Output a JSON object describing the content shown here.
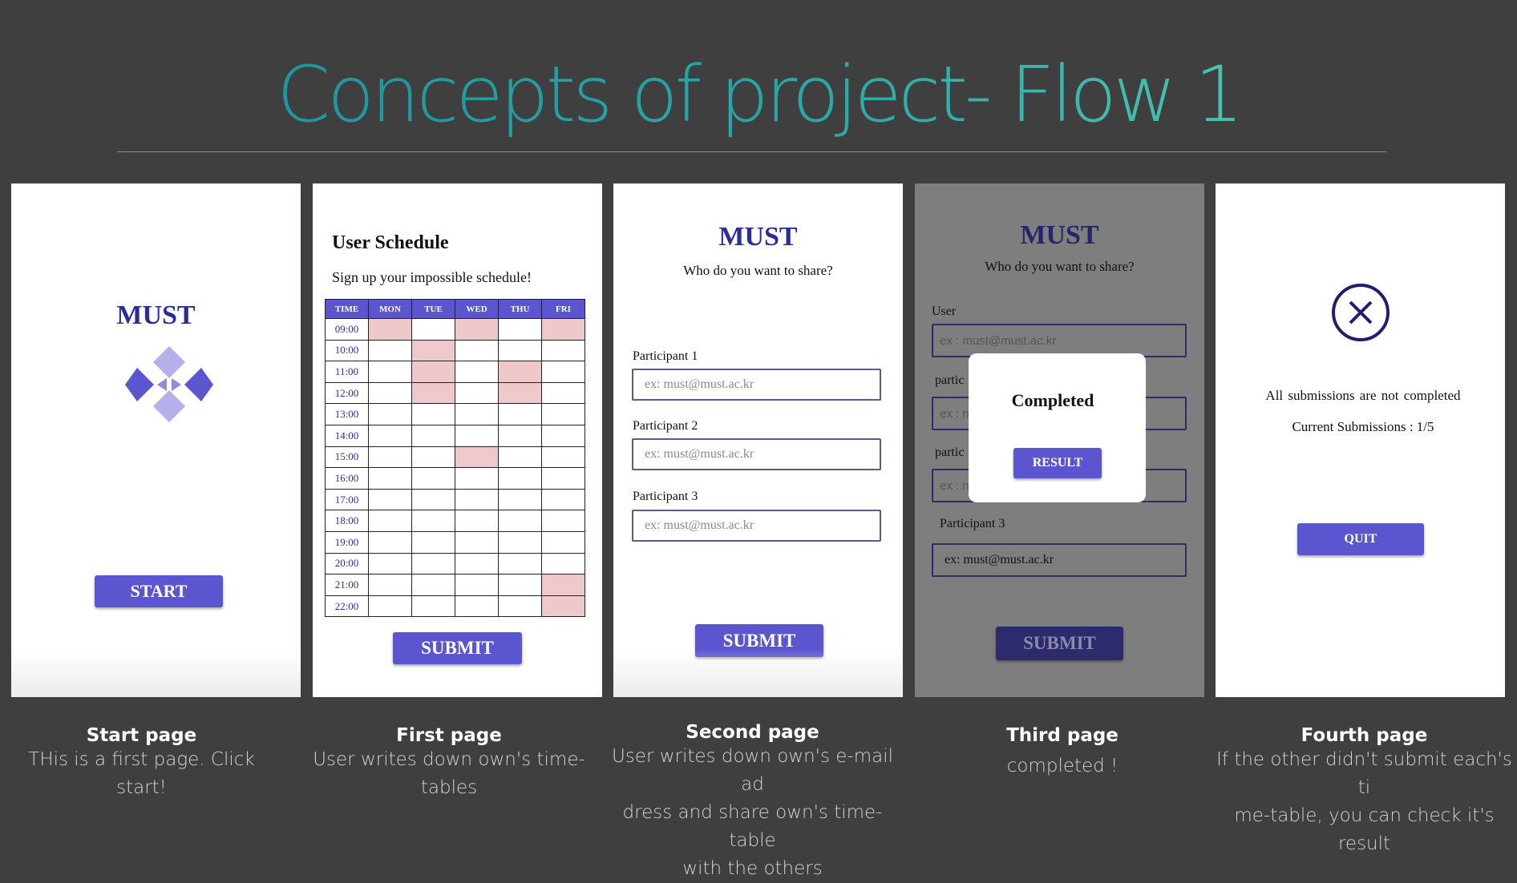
{
  "title": "Concepts of project- Flow 1",
  "brand": "MUST",
  "panels": {
    "start": {
      "button": "START"
    },
    "first": {
      "heading": "User Schedule",
      "subheading": "Sign up your impossible schedule!",
      "columns": [
        "TIME",
        "MON",
        "TUE",
        "WED",
        "THU",
        "FRI"
      ],
      "times": [
        "09:00",
        "10:00",
        "11:00",
        "12:00",
        "13:00",
        "14:00",
        "15:00",
        "16:00",
        "17:00",
        "18:00",
        "19:00",
        "20:00",
        "21:00",
        "22:00"
      ],
      "button": "SUBMIT"
    },
    "second": {
      "question": "Who do you want to share?",
      "participant1_label": "Participant 1",
      "participant2_label": "Participant 2",
      "participant3_label": "Participant 3",
      "placeholder": "ex: must@must.ac.kr",
      "button": "SUBMIT"
    },
    "third": {
      "question": "Who do you want to share?",
      "user_label": "User",
      "user_placeholder": "ex : must@must.ac.kr",
      "partial_label": "partic",
      "partial_placeholder": "ex : n",
      "participant3_label": "Participant 3",
      "participant3_value": "ex: must@must.ac.kr",
      "button": "SUBMIT",
      "modal_title": "Completed",
      "modal_button": "RESULT"
    },
    "fourth": {
      "message": "All submissions are not completed",
      "submissions": "Current Submissions : 1/5",
      "button": "QUIT",
      "icon": "close-circle-icon"
    }
  },
  "captions": [
    {
      "title": "Start page",
      "body": "THis is a first page. Click start!"
    },
    {
      "title": "First page",
      "body": "User writes down own's time-tables"
    },
    {
      "title": "Second page",
      "body": [
        "User writes down own's e-mail ad",
        "dress and share own's time-table",
        "with the others"
      ]
    },
    {
      "title": "Third page",
      "body": "completed !"
    },
    {
      "title": "Fourth page",
      "body": [
        "If the other didn't submit each's ti",
        "me-table, you can check it's result"
      ]
    }
  ],
  "colors": {
    "accent": "#5b55cf",
    "brand": "#2d2d9a",
    "booked": "#eec8cb",
    "background": "#3f3f3f"
  }
}
